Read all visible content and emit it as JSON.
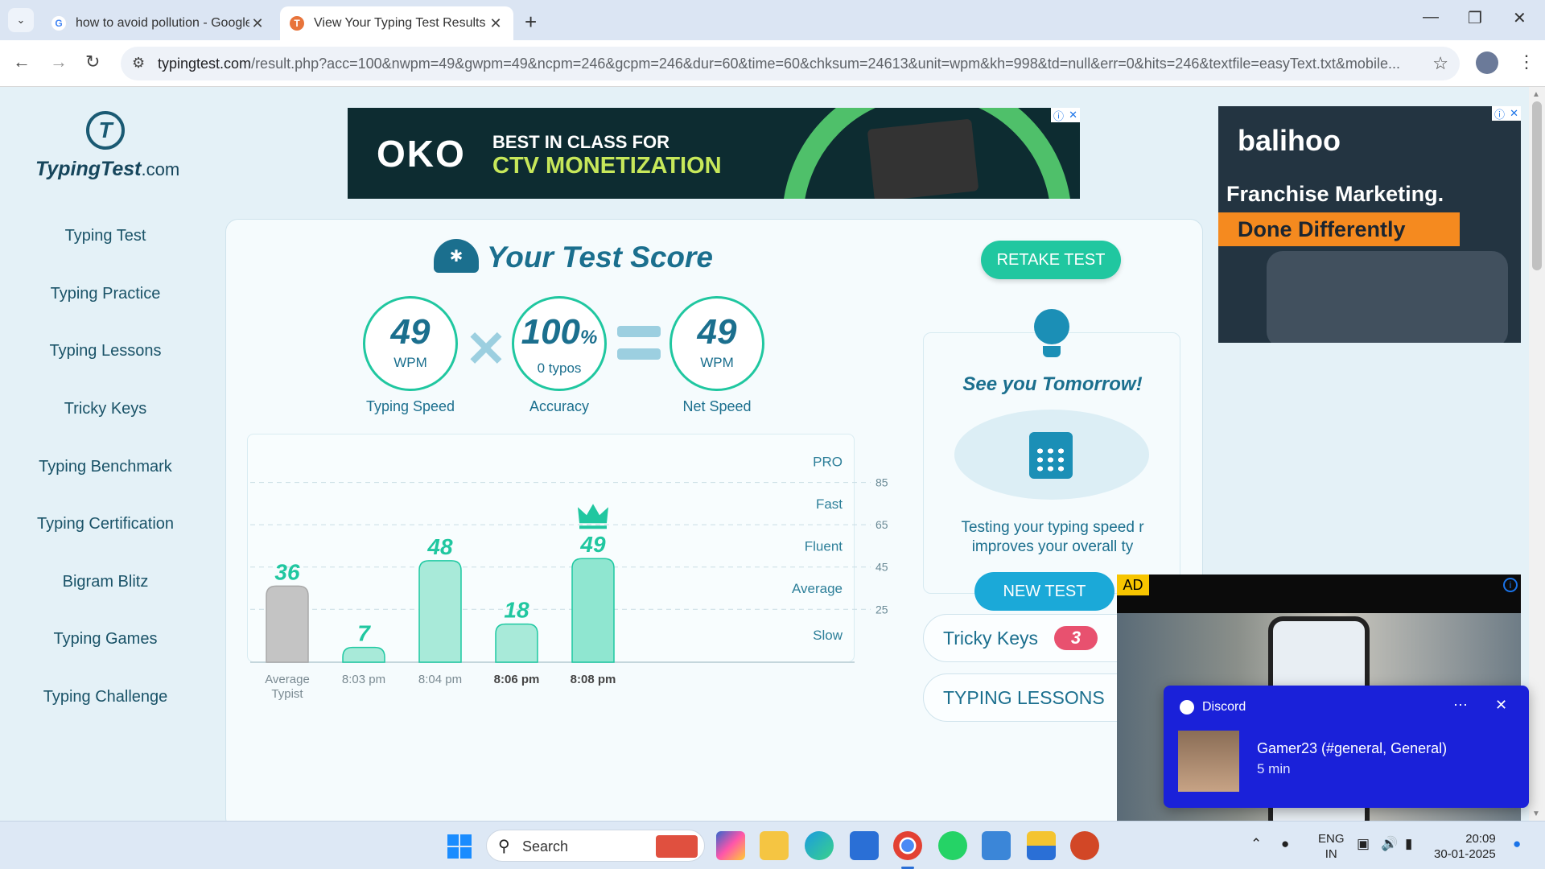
{
  "browser": {
    "tabs": [
      {
        "title": "how to avoid pollution - Google",
        "favicon": "google-icon",
        "active": false
      },
      {
        "title": "View Your Typing Test Results",
        "favicon": "typingtest-icon",
        "active": true
      }
    ],
    "url_domain": "typingtest.com",
    "url_rest": "/result.php?acc=100&nwpm=49&gwpm=49&ncpm=246&gcpm=246&dur=60&time=60&chksum=24613&unit=wpm&kh=998&td=null&err=0&hits=246&textfile=easyText.txt&mobile...",
    "icons": [
      "chevron-down-icon",
      "back-icon",
      "forward-icon",
      "reload-icon",
      "site-settings-icon",
      "star-icon",
      "profile-icon",
      "menu-icon",
      "minimize-icon",
      "maximize-icon",
      "close-icon"
    ]
  },
  "site": {
    "logo_main": "TypingTest",
    "logo_suffix": ".com",
    "nav": [
      "Typing Test",
      "Typing Practice",
      "Typing Lessons",
      "Tricky Keys",
      "Typing Benchmark",
      "Typing Certification",
      "Bigram Blitz",
      "Typing Games",
      "Typing Challenge"
    ]
  },
  "ads": {
    "top_brand": "OKO",
    "top_line1": "BEST IN CLASS FOR",
    "top_line2": "CTV MONETIZATION",
    "right_brand": "balihoo",
    "right_line1": "Franchise Marketing.",
    "right_line2": "Done Differently",
    "video_label": "AD",
    "accent_colors": {
      "oko_green": "#c7e85a",
      "balihoo_orange": "#f58a1f",
      "ad_yellow": "#f7c500"
    }
  },
  "score": {
    "title": "Your Test Score",
    "retake_label": "RETAKE TEST",
    "typing_speed": {
      "value": "49",
      "unit": "WPM",
      "label": "Typing Speed"
    },
    "accuracy": {
      "value": "100",
      "suffix": "%",
      "sub": "0 typos",
      "label": "Accuracy"
    },
    "net_speed": {
      "value": "49",
      "unit": "WPM",
      "label": "Net Speed"
    }
  },
  "chart_data": {
    "type": "bar",
    "categories": [
      "Average Typist",
      "8:03 pm",
      "8:04 pm",
      "8:06 pm",
      "8:08 pm"
    ],
    "values": [
      36,
      7,
      48,
      18,
      49
    ],
    "bar_colors": [
      "#c4c4c4",
      "#a8ead9",
      "#a8ead9",
      "#a8ead9",
      "#8fe6d0"
    ],
    "highlight_index": 4,
    "highlight_icon": "crown-icon",
    "ylim": [
      0,
      105
    ],
    "gridlines": [
      25,
      45,
      65,
      85
    ],
    "levels": [
      {
        "label": "PRO",
        "value": 95
      },
      {
        "label": "Fast",
        "value": 75
      },
      {
        "label": "Fluent",
        "value": 55
      },
      {
        "label": "Average",
        "value": 35
      },
      {
        "label": "Slow",
        "value": 13
      }
    ],
    "grid": "dashed",
    "accent": "#20c7a0"
  },
  "side": {
    "see_you": "See you Tomorrow!",
    "testing_text_1": "Testing your typing speed r",
    "testing_text_2": "improves your overall ty",
    "new_test_label": "NEW TEST",
    "tricky_keys_label": "Tricky Keys",
    "tricky_keys_count": "3",
    "typing_lessons_label": "TYPING LESSONS"
  },
  "toast": {
    "app": "Discord",
    "message": "Gamer23 (#general, General)",
    "time": "5 min"
  },
  "taskbar": {
    "search_placeholder": "Search",
    "lang_1": "ENG",
    "lang_2": "IN",
    "time": "20:09",
    "date": "30-01-2025",
    "apps": [
      "copilot-icon",
      "file-explorer-icon",
      "edge-icon",
      "store-icon",
      "chrome-icon",
      "whatsapp-icon",
      "photos-icon",
      "widgets-icon",
      "powerpoint-icon"
    ]
  }
}
